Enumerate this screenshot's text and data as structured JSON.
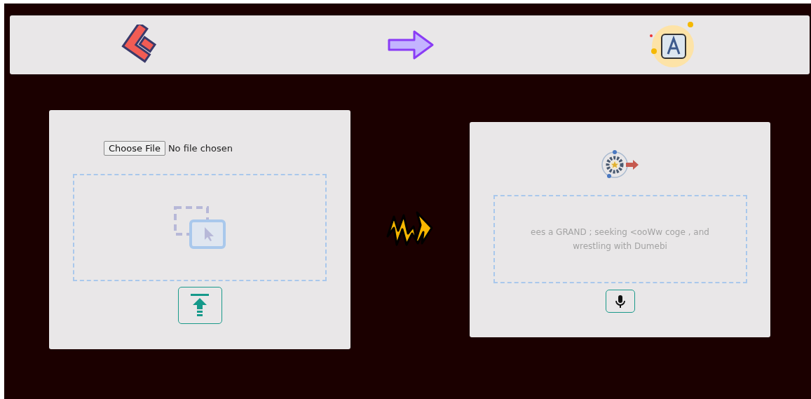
{
  "file_input": {
    "button": "Choose File",
    "status": "No file chosen"
  },
  "transcript": {
    "text": "ees a GRAND ; seeking <ooWw coge , and wrestling with Dumebi"
  }
}
